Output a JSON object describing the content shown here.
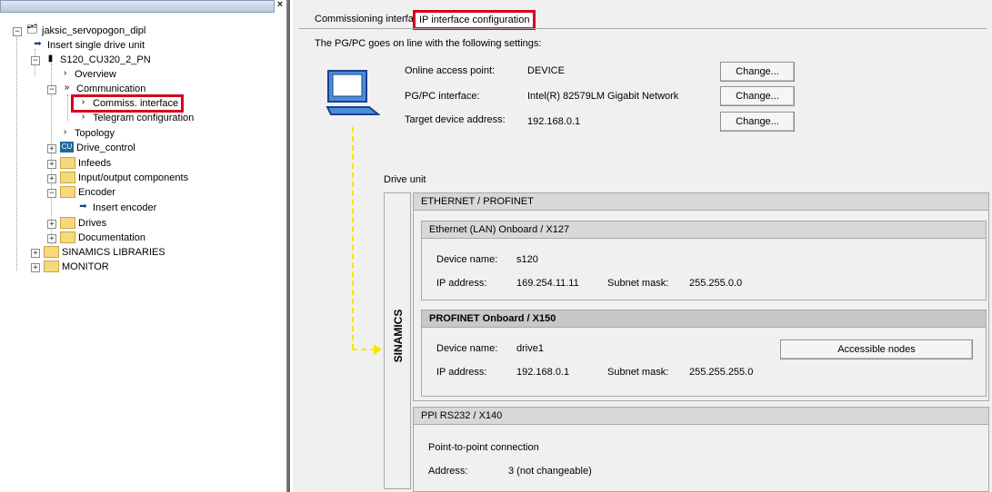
{
  "tree": {
    "root": "jaksic_servopogon_dipl",
    "items": [
      {
        "label": "Insert single drive unit"
      },
      {
        "label": "S120_CU320_2_PN"
      },
      {
        "label": "Overview"
      },
      {
        "label": "Communication"
      },
      {
        "label": "Commiss. interface"
      },
      {
        "label": "Telegram configuration"
      },
      {
        "label": "Topology"
      },
      {
        "label": "Drive_control"
      },
      {
        "label": "Infeeds"
      },
      {
        "label": "Input/output components"
      },
      {
        "label": "Encoder"
      },
      {
        "label": "Insert encoder"
      },
      {
        "label": "Drives"
      },
      {
        "label": "Documentation"
      },
      {
        "label": "SINAMICS LIBRARIES"
      },
      {
        "label": "MONITOR"
      }
    ],
    "close_glyph": "×"
  },
  "tabs": [
    {
      "label": "Commissioning interfaces"
    },
    {
      "label": "IP interface configuration"
    }
  ],
  "intro": "The PG/PC goes on line with the following settings:",
  "online": {
    "access_point_label": "Online access point:",
    "access_point_value": "DEVICE",
    "pgpc_label": "PG/PC interface:",
    "pgpc_value": "Intel(R) 82579LM Gigabit Network",
    "target_label": "Target device address:",
    "target_value": "192.168.0.1",
    "change_label": "Change..."
  },
  "drive_unit": {
    "label": "Drive unit",
    "side_label": "SINAMICS",
    "ethernet_header": "ETHERNET / PROFINET",
    "x127": {
      "header": "Ethernet (LAN) Onboard / X127",
      "device_name_label": "Device name:",
      "device_name": "s120",
      "ip_label": "IP address:",
      "ip": "169.254.11.11",
      "subnet_label": "Subnet mask:",
      "subnet": "255.255.0.0"
    },
    "x150": {
      "header": "PROFINET Onboard / X150",
      "device_name_label": "Device name:",
      "device_name": "drive1",
      "ip_label": "IP address:",
      "ip": "192.168.0.1",
      "subnet_label": "Subnet mask:",
      "subnet": "255.255.255.0",
      "accessible_nodes": "Accessible nodes"
    },
    "x140": {
      "header": "PPI RS232 / X140",
      "connection": "Point-to-point connection",
      "address_label": "Address:",
      "address": "3 (not changeable)"
    }
  },
  "colors": {
    "highlight": "#d6001c",
    "cable": "#f5e600"
  }
}
